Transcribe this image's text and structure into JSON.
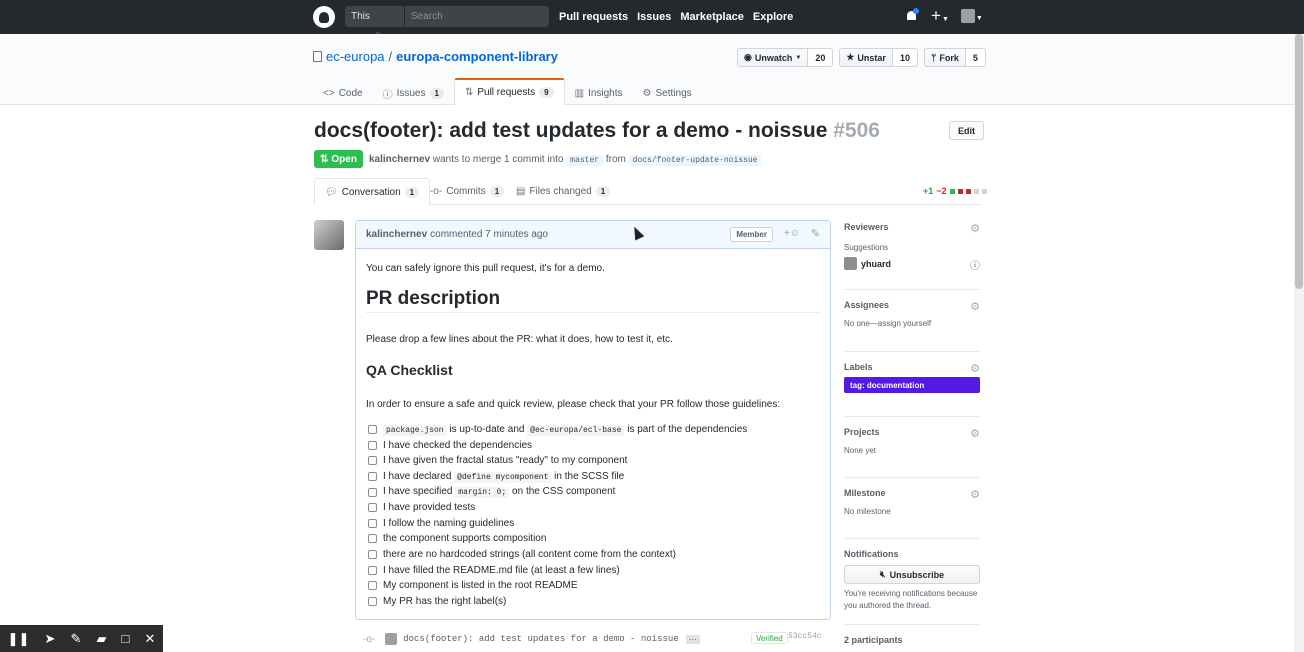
{
  "header": {
    "search_scope": "This repository",
    "search_placeholder": "Search",
    "nav": [
      "Pull requests",
      "Issues",
      "Marketplace",
      "Explore"
    ]
  },
  "repo": {
    "owner": "ec-europa",
    "name": "europa-component-library",
    "watch_label": "Unwatch",
    "watch_count": "20",
    "star_label": "Unstar",
    "star_count": "10",
    "fork_label": "Fork",
    "fork_count": "5"
  },
  "reponav": [
    {
      "label": "Code",
      "counter": ""
    },
    {
      "label": "Issues",
      "counter": "1"
    },
    {
      "label": "Pull requests",
      "counter": "9"
    },
    {
      "label": "Insights",
      "counter": ""
    },
    {
      "label": "Settings",
      "counter": ""
    }
  ],
  "pr": {
    "title": "docs(footer): add test updates for a demo - noissue",
    "number": "#506",
    "edit_label": "Edit",
    "state": "Open",
    "author": "kalinchernev",
    "merge_text": "wants to merge 1 commit into",
    "base_branch": "master",
    "from_text": "from",
    "head_branch": "docs/footer-update-noissue"
  },
  "tabs": [
    {
      "label": "Conversation",
      "counter": "1"
    },
    {
      "label": "Commits",
      "counter": "1"
    },
    {
      "label": "Files changed",
      "counter": "1"
    }
  ],
  "diffstat": {
    "additions": "+1",
    "deletions": "−2"
  },
  "comment": {
    "author": "kalinchernev",
    "action": "commented 7 minutes ago",
    "badge": "Member",
    "intro": "You can safely ignore this pull request, it's for a demo.",
    "h1": "PR description",
    "drop": "Please drop a few lines about the PR: what it does, how to test it, etc.",
    "h2": "QA Checklist",
    "order": "In order to ensure a safe and quick review, please check that your PR follow those guidelines:",
    "checklist": [
      {
        "pre": "",
        "code": "package.json",
        "mid": " is up-to-date and ",
        "code2": "@ec-europa/ecl-base",
        "post": " is part of the dependencies"
      },
      {
        "text": "I have checked the dependencies"
      },
      {
        "text": "I have given the fractal status \"ready\" to my component"
      },
      {
        "pre": "I have declared ",
        "code": "@define mycomponent",
        "post": " in the SCSS file"
      },
      {
        "pre": "I have specified ",
        "code": "margin: 0;",
        "post": " on the CSS component"
      },
      {
        "text": "I have provided tests"
      },
      {
        "text": "I follow the naming guidelines"
      },
      {
        "text": "the component supports composition"
      },
      {
        "text": "there are no hardcoded strings (all content come from the context)"
      },
      {
        "text": "I have filled the README.md file (at least a few lines)"
      },
      {
        "text": "My component is listed in the root README"
      },
      {
        "text": "My PR has the right label(s)"
      }
    ]
  },
  "commit": {
    "message": "docs(footer): add test updates for a demo - noissue",
    "ellipsis": "···",
    "verified": "Verified",
    "sha": "53cc54c"
  },
  "sidebar": {
    "reviewers": {
      "heading": "Reviewers",
      "sub": "Suggestions",
      "user": "yhuard"
    },
    "assignees": {
      "heading": "Assignees",
      "text": "No one—assign yourself"
    },
    "labels": {
      "heading": "Labels",
      "label": "tag: documentation",
      "color": "#5319e7"
    },
    "projects": {
      "heading": "Projects",
      "text": "None yet"
    },
    "milestone": {
      "heading": "Milestone",
      "text": "No milestone"
    },
    "notifications": {
      "heading": "Notifications",
      "button": "Unsubscribe",
      "reason": "You're receiving notifications because you authored the thread."
    },
    "participants": {
      "heading": "2 participants"
    }
  }
}
